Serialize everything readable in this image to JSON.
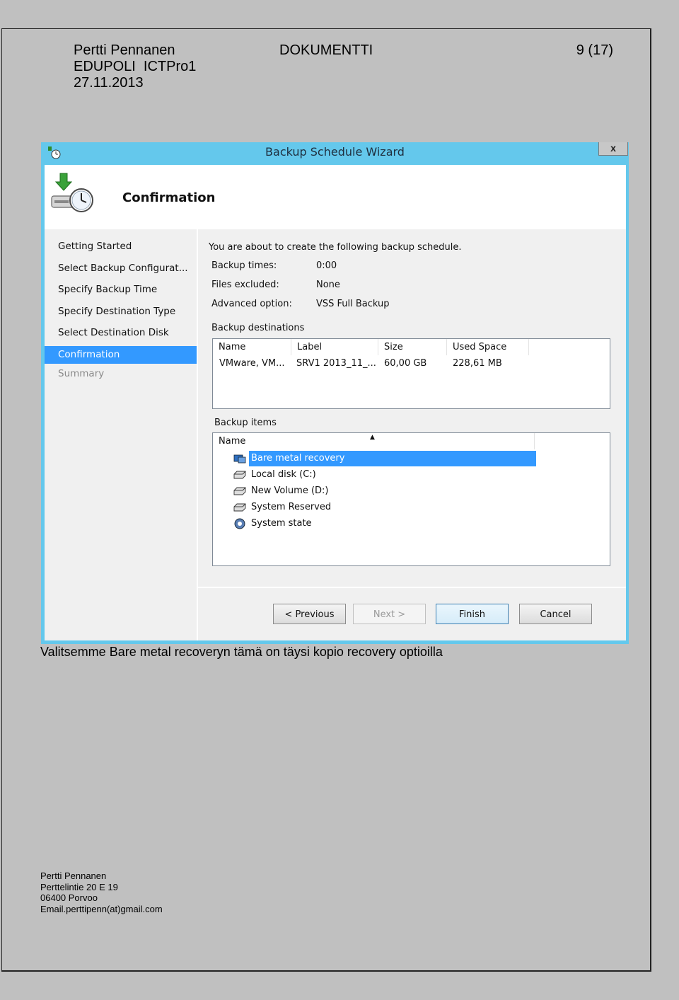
{
  "doc": {
    "author": "Pertti Pennanen",
    "org": "EDUPOLI  ICTPro1",
    "date": "27.11.2013",
    "doc_type": "DOKUMENTTI",
    "page": "9 (17)",
    "caption": "Valitsemme Bare metal recoveryn tämä on täysi kopio recovery optioilla",
    "footer": {
      "name": "Pertti Pennanen",
      "street": "Perttelintie 20 E 19",
      "city": "06400 Porvoo",
      "email": "Email.perttipenn(at)gmail.com"
    }
  },
  "wizard": {
    "title": "Backup Schedule Wizard",
    "close_label": "x",
    "heading": "Confirmation",
    "nav": [
      {
        "label": "Getting Started",
        "state": "normal"
      },
      {
        "label": "Select Backup Configurat...",
        "state": "normal"
      },
      {
        "label": "Specify Backup Time",
        "state": "normal"
      },
      {
        "label": "Specify Destination Type",
        "state": "normal"
      },
      {
        "label": "Select Destination Disk",
        "state": "normal"
      },
      {
        "label": "Confirmation",
        "state": "selected"
      },
      {
        "label": "Summary",
        "state": "disabled"
      }
    ],
    "intro": "You are about to create the following backup schedule.",
    "summary": [
      {
        "label": "Backup times:",
        "value": "0:00"
      },
      {
        "label": "Files excluded:",
        "value": "None"
      },
      {
        "label": "Advanced option:",
        "value": "VSS Full Backup"
      }
    ],
    "destinations": {
      "title": "Backup destinations",
      "columns": [
        "Name",
        "Label",
        "Size",
        "Used Space"
      ],
      "rows": [
        [
          "VMware, VM...",
          "SRV1 2013_11_...",
          "60,00 GB",
          "228,61 MB"
        ]
      ]
    },
    "items": {
      "title": "Backup items",
      "column": "Name",
      "sort_indicator": "▲",
      "list": [
        {
          "label": "Bare metal recovery",
          "icon": "bare-metal-icon",
          "selected": true
        },
        {
          "label": "Local disk (C:)",
          "icon": "disk-icon",
          "selected": false
        },
        {
          "label": "New Volume (D:)",
          "icon": "disk-icon",
          "selected": false
        },
        {
          "label": "System Reserved",
          "icon": "disk-icon",
          "selected": false
        },
        {
          "label": "System state",
          "icon": "system-state-icon",
          "selected": false
        }
      ]
    },
    "buttons": {
      "previous": "< Previous",
      "next": "Next >",
      "finish": "Finish",
      "cancel": "Cancel"
    }
  }
}
